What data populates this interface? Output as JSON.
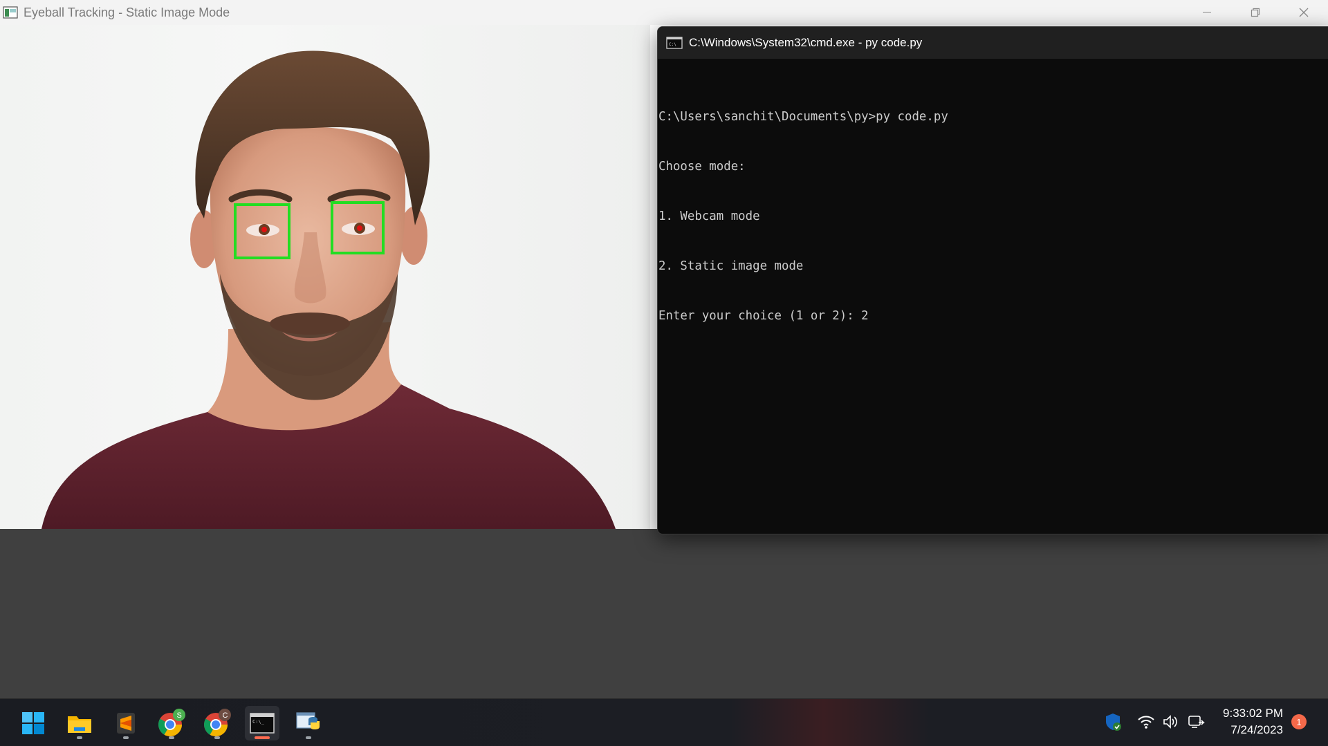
{
  "image_window": {
    "title": "Eyeball Tracking - Static Image Mode",
    "controls": [
      "minimize-icon",
      "restore-icon",
      "close-icon"
    ]
  },
  "photo": {
    "subject": "face",
    "detections": [
      {
        "label": "left-eye",
        "box_color": "#22dd22"
      },
      {
        "label": "right-eye",
        "box_color": "#22dd22"
      }
    ]
  },
  "cmd": {
    "title": "C:\\Windows\\System32\\cmd.exe - py  code.py",
    "lines": [
      "C:\\Users\\sanchit\\Documents\\py>py code.py",
      "Choose mode:",
      "1. Webcam mode",
      "2. Static image mode",
      "Enter your choice (1 or 2): 2"
    ]
  },
  "taskbar": {
    "apps": [
      {
        "icon": "windows-start-icon"
      },
      {
        "icon": "file-explorer-icon"
      },
      {
        "icon": "sublime-text-icon"
      },
      {
        "icon": "chrome-profile-s-icon",
        "badge": "S"
      },
      {
        "icon": "chrome-profile-c-icon",
        "badge": "C"
      },
      {
        "icon": "terminal-icon",
        "active": true
      },
      {
        "icon": "python-idle-icon"
      }
    ],
    "tray": [
      "defender-shield-icon",
      "wifi-icon",
      "volume-icon",
      "sync-icon"
    ],
    "time": "9:33:02 PM",
    "date": "7/24/2023",
    "notification_count": "1"
  },
  "colors": {
    "detection_box": "#22dd22",
    "desktop_bg": "#404040",
    "cmd_bg": "#0c0c0c",
    "cmd_text": "#cccccc",
    "notification": "#f4694a"
  }
}
